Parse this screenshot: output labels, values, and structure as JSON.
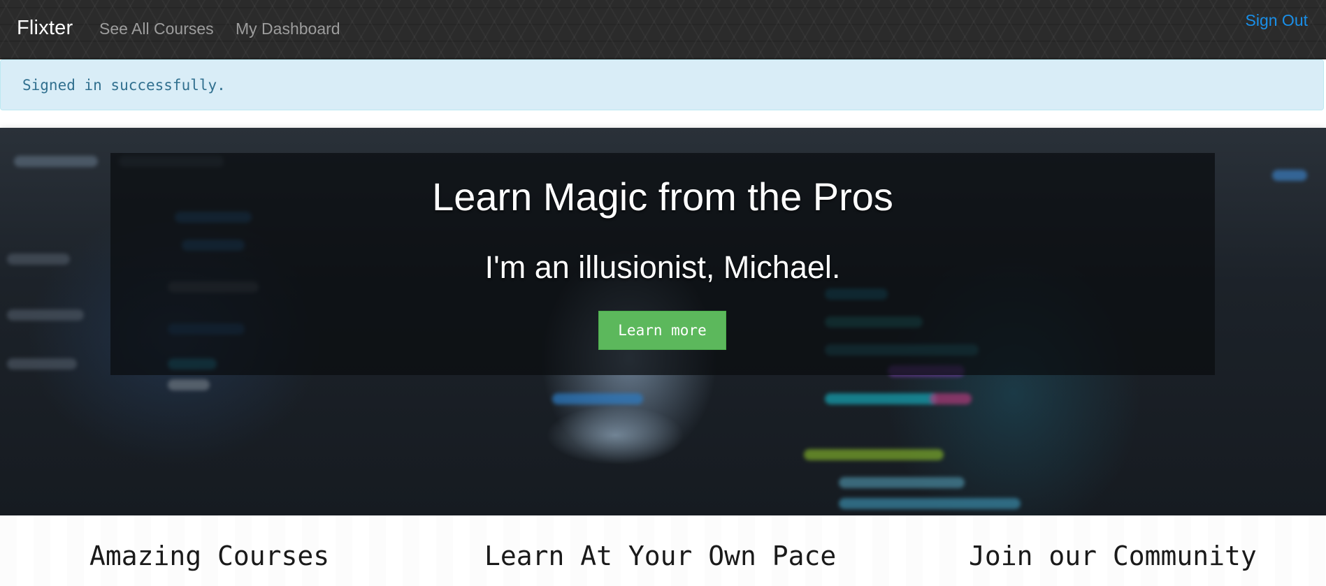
{
  "navbar": {
    "brand": "Flixter",
    "links": [
      {
        "label": "See All Courses"
      },
      {
        "label": "My Dashboard"
      }
    ],
    "sign_out": "Sign Out"
  },
  "flash": {
    "message": "Signed in successfully."
  },
  "hero": {
    "title": "Learn Magic from the Pros",
    "subtitle": "I'm an illusionist, Michael.",
    "button_label": "Learn more"
  },
  "features": [
    {
      "heading": "Amazing Courses"
    },
    {
      "heading": "Learn At Your Own Pace"
    },
    {
      "heading": "Join our Community"
    }
  ],
  "colors": {
    "navbar_bg": "#2b2b2b",
    "link_gray": "#9d9d9d",
    "sign_out_blue": "#1a8fe8",
    "flash_bg": "#d9edf7",
    "flash_text": "#31708f",
    "button_green": "#5cb85c"
  }
}
